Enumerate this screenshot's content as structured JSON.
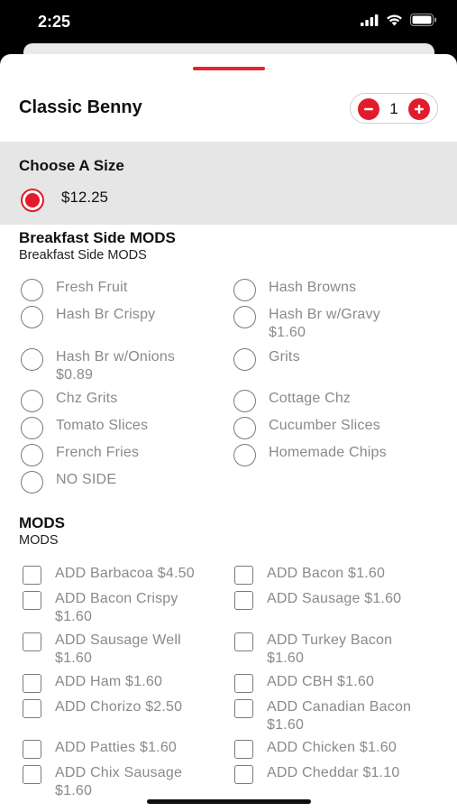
{
  "status_bar": {
    "time": "2:25"
  },
  "header": {
    "title": "Classic Benny",
    "quantity": "1"
  },
  "size": {
    "heading": "Choose A Size",
    "options": [
      {
        "price": "$12.25",
        "selected": true
      }
    ]
  },
  "breakfast_side": {
    "title": "Breakfast Side MODS",
    "subtitle": "Breakfast Side MODS",
    "options": [
      {
        "name": "Fresh Fruit"
      },
      {
        "name": "Hash Browns"
      },
      {
        "name": "Hash Br Crispy"
      },
      {
        "name": "Hash Br w/Gravy",
        "price": "$1.60"
      },
      {
        "name": "Hash Br w/Onions",
        "price": "$0.89"
      },
      {
        "name": "Grits"
      },
      {
        "name": "Chz Grits"
      },
      {
        "name": "Cottage Chz"
      },
      {
        "name": "Tomato Slices"
      },
      {
        "name": "Cucumber Slices"
      },
      {
        "name": "French Fries"
      },
      {
        "name": "Homemade Chips"
      },
      {
        "name": "NO SIDE"
      }
    ]
  },
  "mods": {
    "title": "MODS",
    "subtitle": "MODS",
    "options": [
      {
        "line1": "ADD Barbacoa $4.50"
      },
      {
        "line1": "ADD Bacon $1.60"
      },
      {
        "line1": "ADD Bacon Crispy",
        "line2": "$1.60"
      },
      {
        "line1": "ADD Sausage $1.60"
      },
      {
        "line1": "ADD Sausage Well",
        "line2": "$1.60"
      },
      {
        "line1": "ADD Turkey Bacon",
        "line2": "$1.60"
      },
      {
        "line1": "ADD Ham $1.60"
      },
      {
        "line1": "ADD CBH $1.60"
      },
      {
        "line1": "ADD Chorizo $2.50"
      },
      {
        "line1": "ADD Canadian Bacon",
        "line2": "$1.60"
      },
      {
        "line1": "ADD Patties $1.60"
      },
      {
        "line1": "ADD Chicken $1.60"
      },
      {
        "line1": "ADD Chix Sausage",
        "line2": "$1.60"
      },
      {
        "line1": "ADD Cheddar $1.10"
      }
    ]
  },
  "colors": {
    "accent": "#e21b2b",
    "section_bg": "#e6e6e6"
  },
  "icons": [
    "signal-icon",
    "wifi-icon",
    "battery-icon",
    "minus-icon",
    "plus-icon"
  ]
}
